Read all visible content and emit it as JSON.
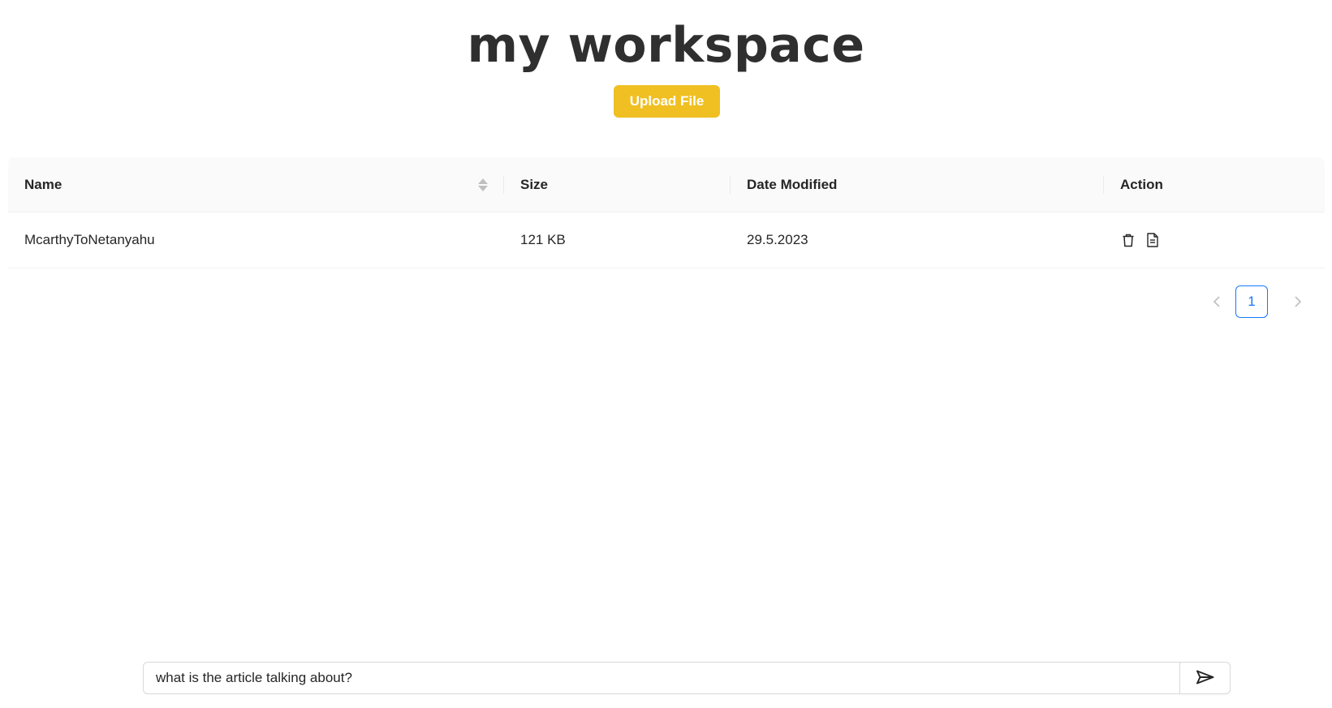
{
  "header": {
    "title": "my workspace",
    "upload_label": "Upload File"
  },
  "table": {
    "columns": {
      "name": "Name",
      "size": "Size",
      "date": "Date Modified",
      "action": "Action"
    },
    "rows": [
      {
        "name": "McarthyToNetanyahu",
        "size": "121 KB",
        "date": "29.5.2023",
        "actions": [
          "delete-icon",
          "file-text-icon"
        ]
      }
    ],
    "sortable_column": "name"
  },
  "pagination": {
    "current_page": "1",
    "prev_icon": "chevron-left-icon",
    "next_icon": "chevron-right-icon"
  },
  "chat": {
    "input_value": "what is the article talking about?",
    "send_icon": "send-icon"
  },
  "colors": {
    "accent": "#f0bf22",
    "pagination_active": "#1677ff"
  }
}
